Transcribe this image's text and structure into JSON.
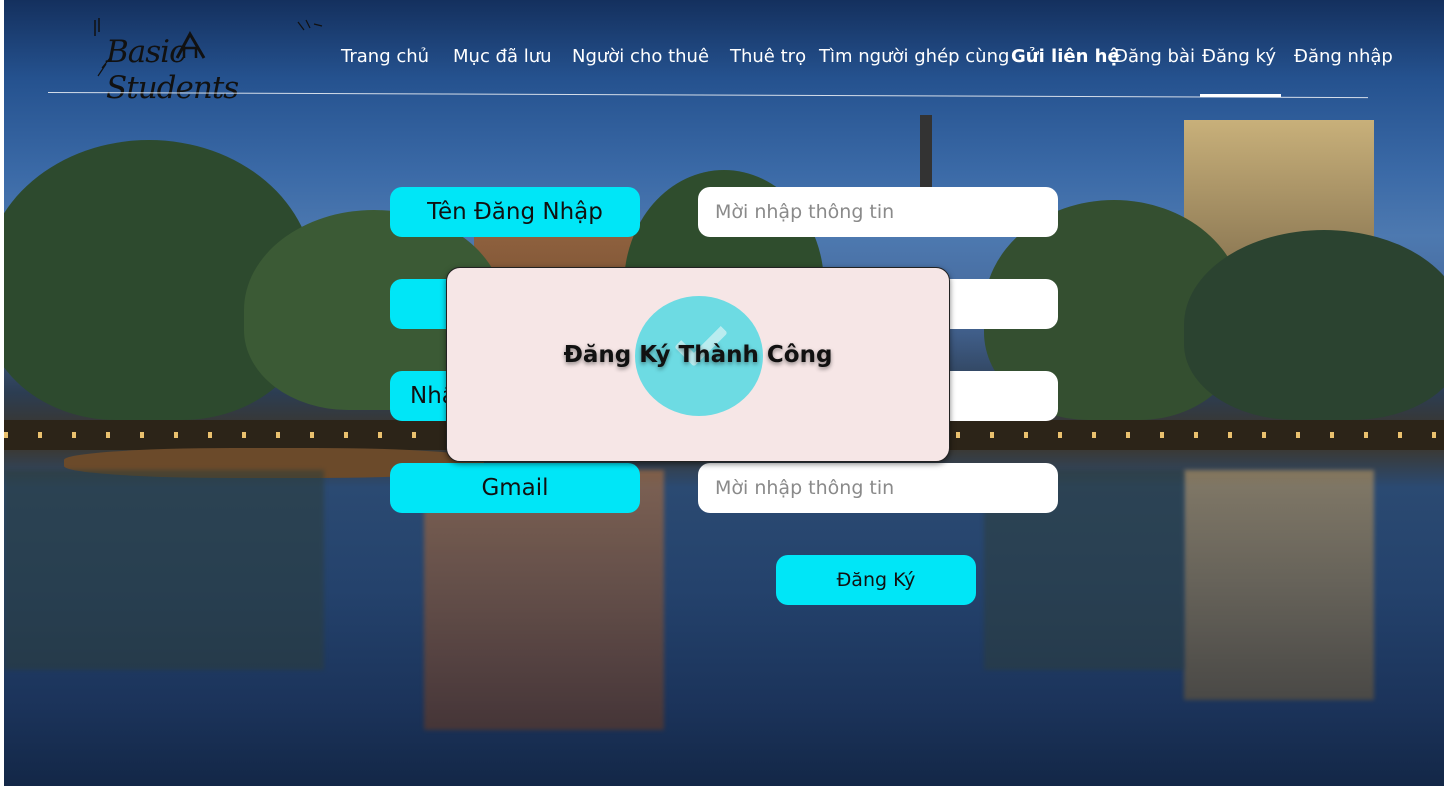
{
  "brand": {
    "logo_text": "Basic Students"
  },
  "nav": {
    "items": [
      {
        "label": "Trang chủ"
      },
      {
        "label": "Mục đã lưu"
      },
      {
        "label": "Người cho thuê"
      },
      {
        "label": "Thuê trọ"
      },
      {
        "label": "Tìm người ghép cùng"
      },
      {
        "label": "Gửi liên hệ"
      },
      {
        "label": "Đăng bài"
      },
      {
        "label": "Đăng ký",
        "active": true
      },
      {
        "label": "Đăng nhập"
      }
    ]
  },
  "form": {
    "fields": [
      {
        "label": "Tên Đăng Nhập",
        "placeholder": "Mời nhập thông tin"
      },
      {
        "label": "",
        "placeholder": ""
      },
      {
        "label": "Nhậ",
        "placeholder": ""
      },
      {
        "label": "Gmail",
        "placeholder": "Mời nhập thông tin"
      }
    ],
    "submit_label": "Đăng Ký"
  },
  "modal": {
    "message": "Đăng Ký Thành Công"
  },
  "colors": {
    "accent": "#00e6f7",
    "modal_bg": "#f6e6e6",
    "check": "#6ddbe3"
  }
}
